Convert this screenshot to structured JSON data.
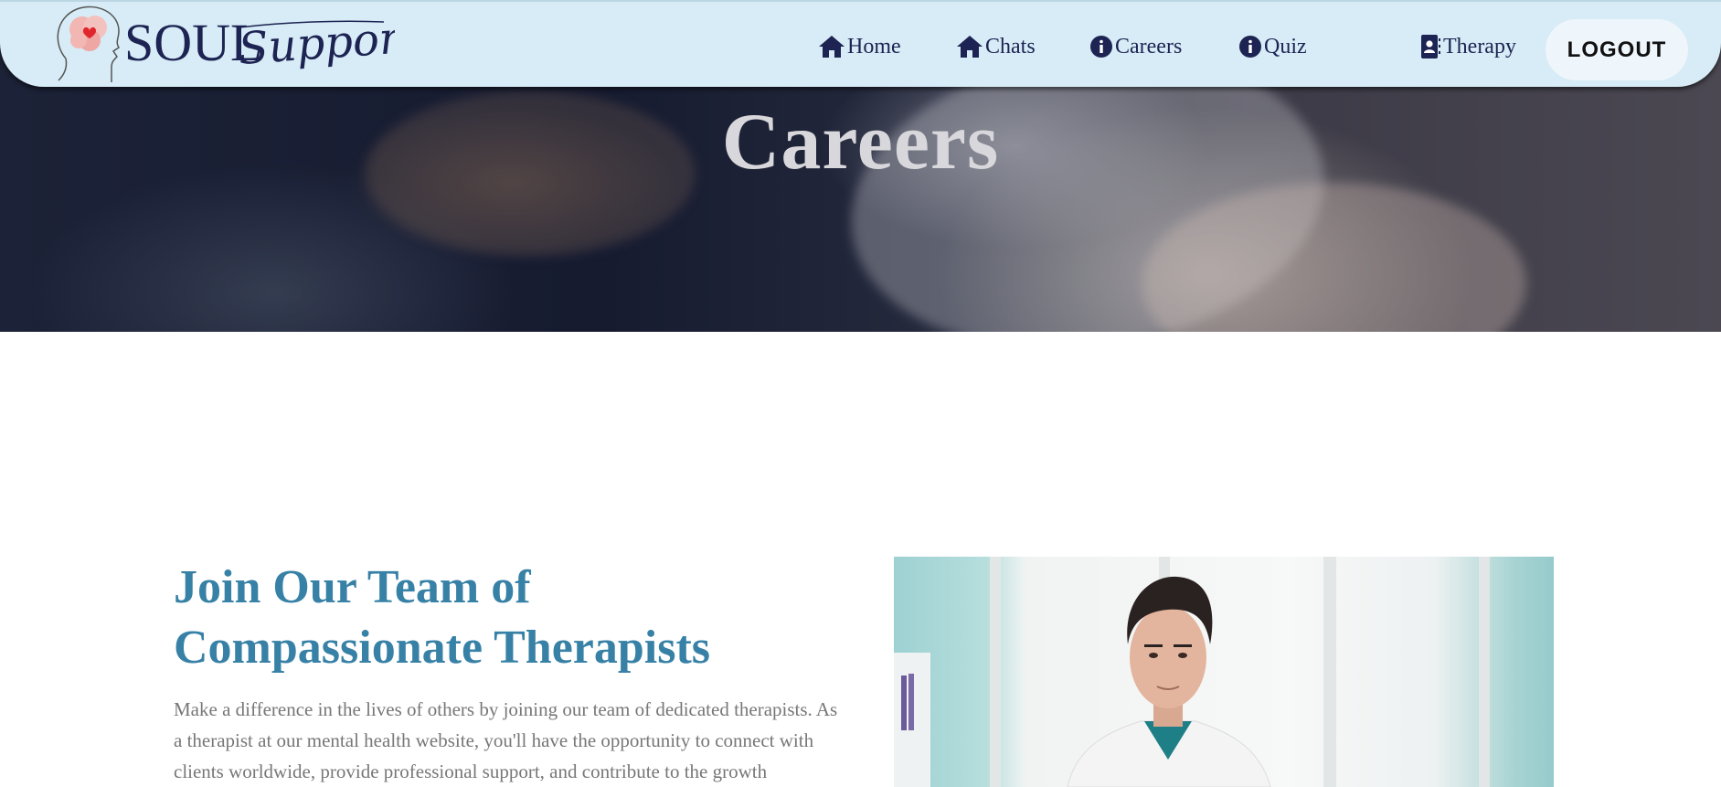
{
  "colors": {
    "navbar_bg": "#d7ecf6",
    "nav_text": "#1d2352",
    "heading": "#3781a6",
    "body_text": "#777777",
    "logout_bg": "#eef5fb"
  },
  "brand": {
    "logo_text_1": "SOUL",
    "logo_text_2": "Support"
  },
  "nav": {
    "items": [
      {
        "label": "Home",
        "icon": "home-icon"
      },
      {
        "label": "Chats",
        "icon": "home-icon"
      },
      {
        "label": "Careers",
        "icon": "info-circle-icon"
      },
      {
        "label": "Quiz",
        "icon": "info-circle-icon"
      },
      {
        "label": "Therapy",
        "icon": "contact-book-icon"
      }
    ],
    "logout_label": "LOGOUT"
  },
  "hero": {
    "title": "Careers"
  },
  "careers": {
    "heading": "Join Our Team of Compassionate Therapists",
    "body": "Make a difference in the lives of others by joining our team of dedicated therapists. As a therapist at our mental health website, you'll have the opportunity to connect with clients worldwide, provide professional support, and contribute to the growth"
  }
}
